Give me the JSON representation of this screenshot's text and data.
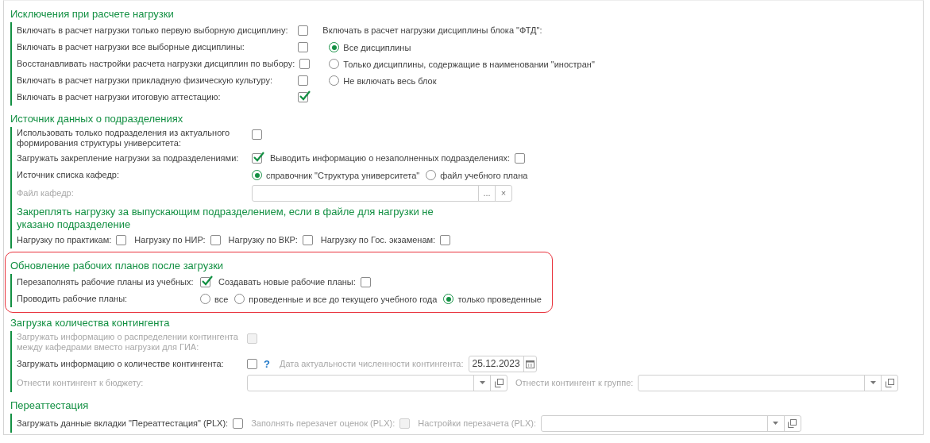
{
  "sections": [
    {
      "kind": "exclusions",
      "title": "Исключения при расчете нагрузки",
      "highlighted": false,
      "options": [
        {
          "label": "Включать в расчет нагрузки только первую выборную дисциплину:",
          "checked": false
        },
        {
          "label": "Включать в расчет нагрузки все выборные дисциплины:",
          "checked": false
        },
        {
          "label": "Восстанавливать настройки расчета нагрузки дисциплин по выбору:",
          "checked": false
        },
        {
          "label": "Включать в расчет нагрузки прикладную физическую культуру:",
          "checked": false
        },
        {
          "label": "Включать в расчет нагрузки итоговую аттестацию:",
          "checked": true
        }
      ],
      "ftd": {
        "label": "Включать в расчет нагрузки дисциплины блока \"ФТД\":",
        "choices": [
          {
            "label": "Все дисциплины",
            "selected": true
          },
          {
            "label": "Только дисциплины, содержащие в наименовании \"иностран\"",
            "selected": false
          },
          {
            "label": "Не включать весь блок",
            "selected": false
          }
        ]
      }
    },
    {
      "kind": "rows",
      "title": "Источник данных о подразделениях",
      "highlighted": false,
      "rows": [
        {
          "kind": "row",
          "label": "Использовать только подразделения из актуального формирования структуры университета:",
          "disabled": false,
          "items": [
            {
              "kind": "checkbox",
              "checked": false,
              "disabled": false
            }
          ]
        },
        {
          "kind": "row",
          "label": "Загружать закрепление нагрузки за подразделениями:",
          "disabled": false,
          "items": [
            {
              "kind": "checkbox",
              "checked": true,
              "disabled": false
            },
            {
              "kind": "label",
              "text": "Выводить информацию о незаполненных подразделениях:",
              "disabled": false
            },
            {
              "kind": "checkbox",
              "checked": false,
              "disabled": false
            }
          ]
        },
        {
          "kind": "row",
          "label": "Источник списка кафедр:",
          "disabled": false,
          "items": [
            {
              "kind": "radio",
              "label": "справочник \"Структура университета\"",
              "selected": true
            },
            {
              "kind": "radio",
              "label": "файл учебного плана",
              "selected": false
            }
          ]
        },
        {
          "kind": "row",
          "label": "Файл кафедр:",
          "disabled": true,
          "items": [
            {
              "kind": "field",
              "value": "",
              "actions": [
                {
                  "kind": "text",
                  "text": "..."
                },
                {
                  "kind": "text",
                  "text": "×"
                }
              ]
            }
          ]
        },
        {
          "kind": "subtitle",
          "text": "Закреплять нагрузку за выпускающим подразделением, если в файле для нагрузки не указано подразделение"
        },
        {
          "kind": "row",
          "items": [
            {
              "kind": "label",
              "text": "Нагрузку по практикам:",
              "disabled": false
            },
            {
              "kind": "checkbox",
              "checked": false,
              "disabled": false
            },
            {
              "kind": "label",
              "text": "Нагрузку по НИР:",
              "disabled": false
            },
            {
              "kind": "checkbox",
              "checked": false,
              "disabled": false
            },
            {
              "kind": "label",
              "text": "Нагрузку по ВКР:",
              "disabled": false
            },
            {
              "kind": "checkbox",
              "checked": false,
              "disabled": false
            },
            {
              "kind": "label",
              "text": "Нагрузку по Гос. экзаменам:",
              "disabled": false
            },
            {
              "kind": "checkbox",
              "checked": false,
              "disabled": false
            }
          ]
        }
      ]
    },
    {
      "kind": "rows",
      "title": "Обновление рабочих планов после загрузки",
      "highlighted": true,
      "rows": [
        {
          "kind": "row",
          "label": "Перезаполнять рабочие планы из учебных:",
          "disabled": false,
          "items": [
            {
              "kind": "checkbox",
              "checked": true,
              "disabled": false
            },
            {
              "kind": "label",
              "text": "Создавать новые рабочие планы:",
              "disabled": false
            },
            {
              "kind": "checkbox",
              "checked": false,
              "disabled": false
            }
          ]
        },
        {
          "kind": "row",
          "label": "Проводить рабочие планы:",
          "disabled": false,
          "items": [
            {
              "kind": "radio",
              "label": "все",
              "selected": false
            },
            {
              "kind": "radio",
              "label": "проведенные и все до текущего учебного года",
              "selected": false
            },
            {
              "kind": "radio",
              "label": "только проведенные",
              "selected": true
            }
          ]
        }
      ]
    },
    {
      "kind": "rows",
      "title": "Загрузка количества контингента",
      "highlighted": false,
      "rows": [
        {
          "kind": "row",
          "label": "Загружать информацию о распределении контингента между кафедрами вместо нагрузки для ГИА:",
          "disabled": true,
          "items": [
            {
              "kind": "checkbox",
              "checked": false,
              "disabled": true
            }
          ]
        },
        {
          "kind": "row",
          "label": "Загружать информацию о количестве контингента:",
          "disabled": false,
          "items": [
            {
              "kind": "checkbox",
              "checked": false,
              "disabled": false
            },
            {
              "kind": "help",
              "text": "?"
            },
            {
              "kind": "label",
              "text": "Дата актуальности численности контингента:",
              "disabled": true
            },
            {
              "kind": "field",
              "value": "25.12.2023",
              "actions": [
                {
                  "kind": "calendar"
                }
              ]
            }
          ]
        },
        {
          "kind": "row",
          "label": "Отнести контингент к бюджету:",
          "disabled": true,
          "items": [
            {
              "kind": "field",
              "value": "",
              "actions": [
                {
                  "kind": "dropdown"
                },
                {
                  "kind": "open"
                }
              ]
            },
            {
              "kind": "label",
              "text": "Отнести контингент к группе:",
              "disabled": true
            },
            {
              "kind": "field",
              "value": "",
              "actions": [
                {
                  "kind": "dropdown"
                },
                {
                  "kind": "open"
                }
              ]
            }
          ]
        }
      ]
    },
    {
      "kind": "rows",
      "title": "Переаттестация",
      "highlighted": false,
      "rows": [
        {
          "kind": "row",
          "items": [
            {
              "kind": "label",
              "text": "Загружать данные вкладки \"Переаттестация\" (PLX):",
              "disabled": false
            },
            {
              "kind": "checkbox",
              "checked": false,
              "disabled": false
            },
            {
              "kind": "label",
              "text": "Заполнять перезачет оценок (PLX):",
              "disabled": true
            },
            {
              "kind": "checkbox",
              "checked": false,
              "disabled": true
            },
            {
              "kind": "label",
              "text": "Настройки перезачета (PLX):",
              "disabled": true
            },
            {
              "kind": "field",
              "value": "",
              "actions": [
                {
                  "kind": "dropdown"
                },
                {
                  "kind": "open"
                }
              ]
            }
          ]
        }
      ]
    }
  ]
}
